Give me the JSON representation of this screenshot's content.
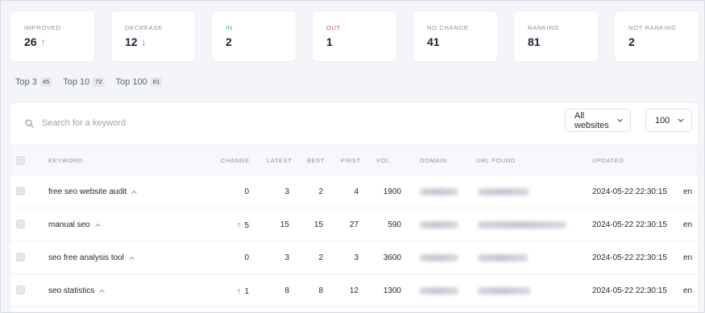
{
  "stats": [
    {
      "label": "IMPROVED",
      "value": "26",
      "arrow": "↑",
      "arrow_kind": "up",
      "label_color": "#8a91a3"
    },
    {
      "label": "DECREASE",
      "value": "12",
      "arrow": "↓",
      "arrow_kind": "down",
      "label_color": "#8a91a3"
    },
    {
      "label": "IN",
      "value": "2",
      "arrow": "",
      "arrow_kind": "",
      "label_color": "#2bb673"
    },
    {
      "label": "OUT",
      "value": "1",
      "arrow": "",
      "arrow_kind": "",
      "label_color": "#e04b5a"
    },
    {
      "label": "NO CHANGE",
      "value": "41",
      "arrow": "",
      "arrow_kind": "",
      "label_color": "#8a91a3"
    },
    {
      "label": "RANKING",
      "value": "81",
      "arrow": "",
      "arrow_kind": "",
      "label_color": "#8a91a3"
    },
    {
      "label": "NOT RANKING",
      "value": "2",
      "arrow": "",
      "arrow_kind": "",
      "label_color": "#8a91a3"
    }
  ],
  "tabs": [
    {
      "label": "Top 3",
      "count": "45"
    },
    {
      "label": "Top 10",
      "count": "72"
    },
    {
      "label": "Top 100",
      "count": "81"
    }
  ],
  "search": {
    "placeholder": "Search for a keyword",
    "icon": "search-icon"
  },
  "filters": {
    "website_select": "All websites",
    "count_select": "100"
  },
  "columns": {
    "keyword": "KEYWORD",
    "change": "CHANGE",
    "latest": "LATEST",
    "best": "BEST",
    "first": "FIRST",
    "vol": "VOL.",
    "domain": "DOMAIN",
    "url_found": "URL FOUND",
    "updated": "UPDATED"
  },
  "rows": [
    {
      "keyword": "free seo website audit",
      "change": "0",
      "change_dir": "",
      "latest": "3",
      "best": "2",
      "first": "4",
      "vol": "1900",
      "updated": "2024-05-22 22:30:15",
      "lang": "en"
    },
    {
      "keyword": "manual seo",
      "change": "5",
      "change_dir": "up",
      "latest": "15",
      "best": "15",
      "first": "27",
      "vol": "590",
      "updated": "2024-05-22 22:30:15",
      "lang": "en"
    },
    {
      "keyword": "seo free analysis tool",
      "change": "0",
      "change_dir": "",
      "latest": "3",
      "best": "2",
      "first": "3",
      "vol": "3600",
      "updated": "2024-05-22 22:30:15",
      "lang": "en"
    },
    {
      "keyword": "seo statistics",
      "change": "1",
      "change_dir": "up",
      "latest": "8",
      "best": "8",
      "first": "12",
      "vol": "1300",
      "updated": "2024-05-22 22:30:15",
      "lang": "en"
    }
  ],
  "colors": {
    "accent_up": "#2bb673",
    "accent_down": "#e04b5a"
  }
}
